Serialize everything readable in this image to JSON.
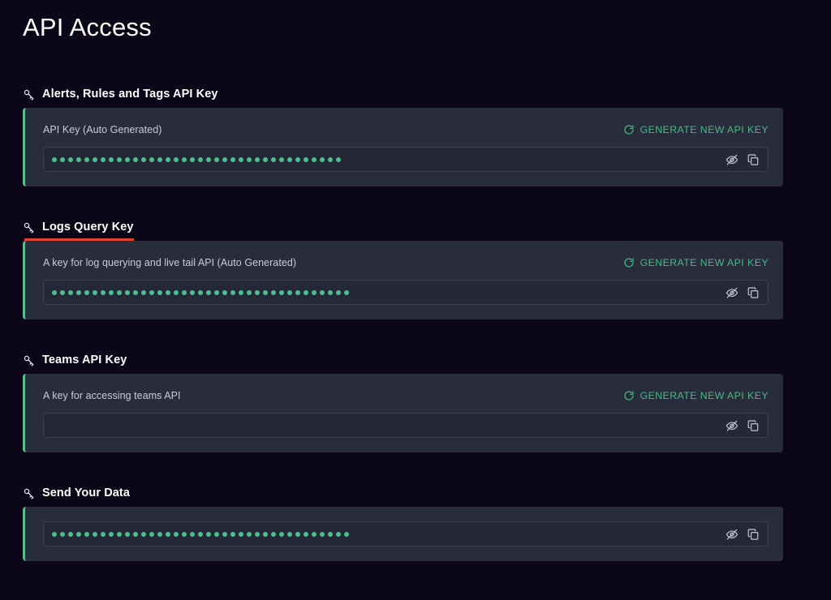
{
  "page": {
    "title": "API Access",
    "background_color": "#0b0718",
    "card_color": "#282c3b",
    "accent_green": "#57bf8e",
    "active_underline_color": "#e1452d",
    "generate_label_color": "#49b98a"
  },
  "icons": {
    "key": "key-icon",
    "refresh": "refresh-icon",
    "hide": "eye-off-icon",
    "copy": "copy-icon"
  },
  "common": {
    "generate_label": "GENERATE NEW API KEY"
  },
  "sections": [
    {
      "id": "alerts-rules-tags-api-key",
      "title": "Alerts, Rules and Tags API Key",
      "description": "API Key (Auto Generated)",
      "has_description": true,
      "has_generate_button": true,
      "generate_label": "GENERATE NEW API KEY",
      "active": false,
      "key_masked": true,
      "key_dots": 36,
      "key_value": "",
      "key_placeholder": ""
    },
    {
      "id": "logs-query-key",
      "title": "Logs Query Key",
      "description": "A key for log querying and live tail API (Auto Generated)",
      "has_description": true,
      "has_generate_button": true,
      "generate_label": "GENERATE NEW API KEY",
      "active": true,
      "key_masked": true,
      "key_dots": 37,
      "key_value": "",
      "key_placeholder": ""
    },
    {
      "id": "teams-api-key",
      "title": "Teams API Key",
      "description": "A key for accessing teams API",
      "has_description": true,
      "has_generate_button": true,
      "generate_label": "GENERATE NEW API KEY",
      "active": false,
      "key_masked": false,
      "key_dots": 0,
      "key_value": "",
      "key_placeholder": ""
    },
    {
      "id": "send-your-data",
      "title": "Send Your Data",
      "description": "",
      "has_description": false,
      "has_generate_button": false,
      "generate_label": "",
      "active": false,
      "key_masked": true,
      "key_dots": 37,
      "key_value": "",
      "key_placeholder": ""
    }
  ]
}
